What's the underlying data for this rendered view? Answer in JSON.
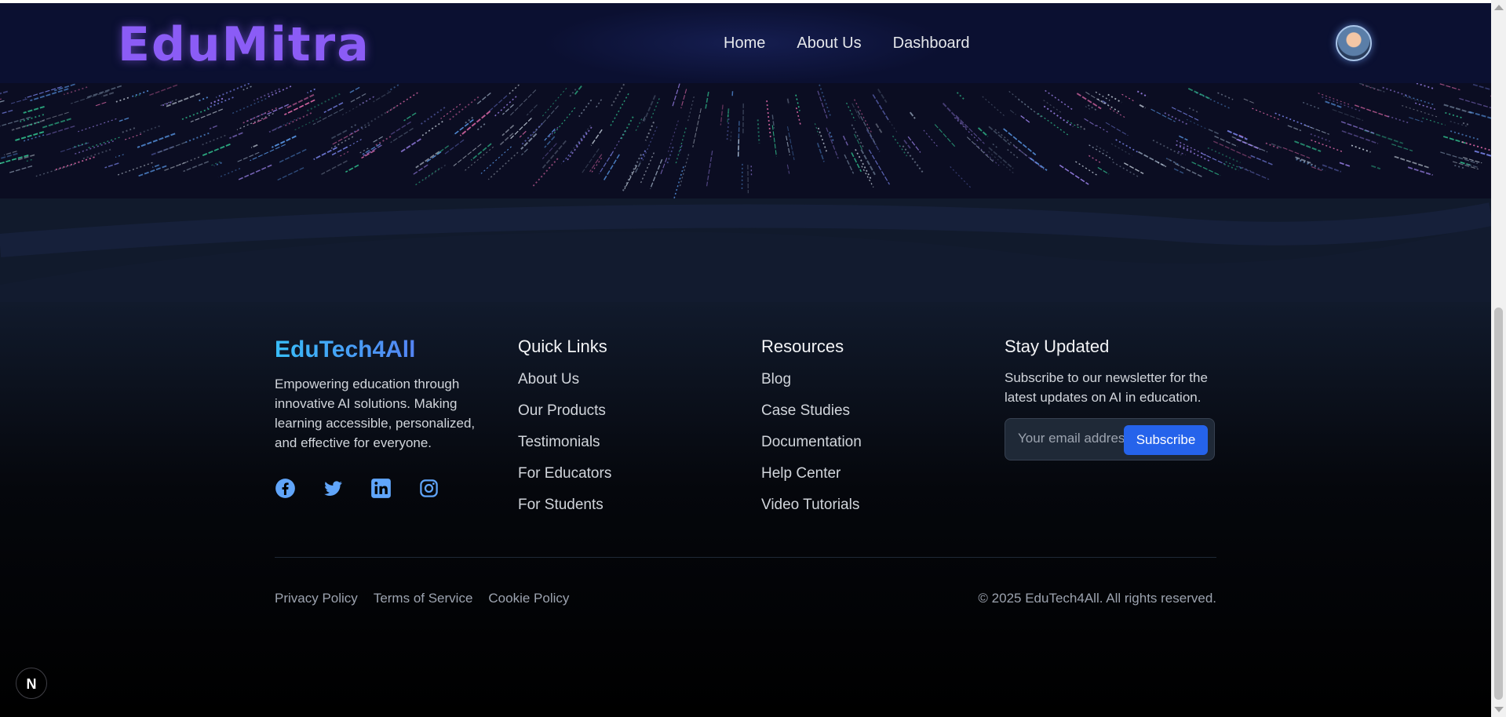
{
  "header": {
    "logo": "EduMitra",
    "nav": [
      "Home",
      "About Us",
      "Dashboard"
    ],
    "avatar_icon": "user-avatar-icon"
  },
  "footer": {
    "brand": "EduTech4All",
    "tagline": "Empowering education through innovative AI solutions. Making learning accessible, personalized, and effective for everyone.",
    "social_icons": [
      "facebook-icon",
      "twitter-icon",
      "linkedin-icon",
      "instagram-icon"
    ],
    "quick_links": {
      "title": "Quick Links",
      "items": [
        "About Us",
        "Our Products",
        "Testimonials",
        "For Educators",
        "For Students"
      ]
    },
    "resources": {
      "title": "Resources",
      "items": [
        "Blog",
        "Case Studies",
        "Documentation",
        "Help Center",
        "Video Tutorials"
      ]
    },
    "newsletter": {
      "title": "Stay Updated",
      "text": "Subscribe to our newsletter for the latest updates on AI in education.",
      "placeholder": "Your email address",
      "button": "Subscribe"
    },
    "legal": [
      "Privacy Policy",
      "Terms of Service",
      "Cookie Policy"
    ],
    "copyright": "© 2025 EduTech4All. All rights reserved."
  },
  "badge": "N",
  "colors": {
    "logo": "#8b5cf6",
    "brand_gradient": [
      "#38bdf8",
      "#6366f1"
    ],
    "subscribe_button": "#2563eb",
    "social": "#60a5fa"
  }
}
